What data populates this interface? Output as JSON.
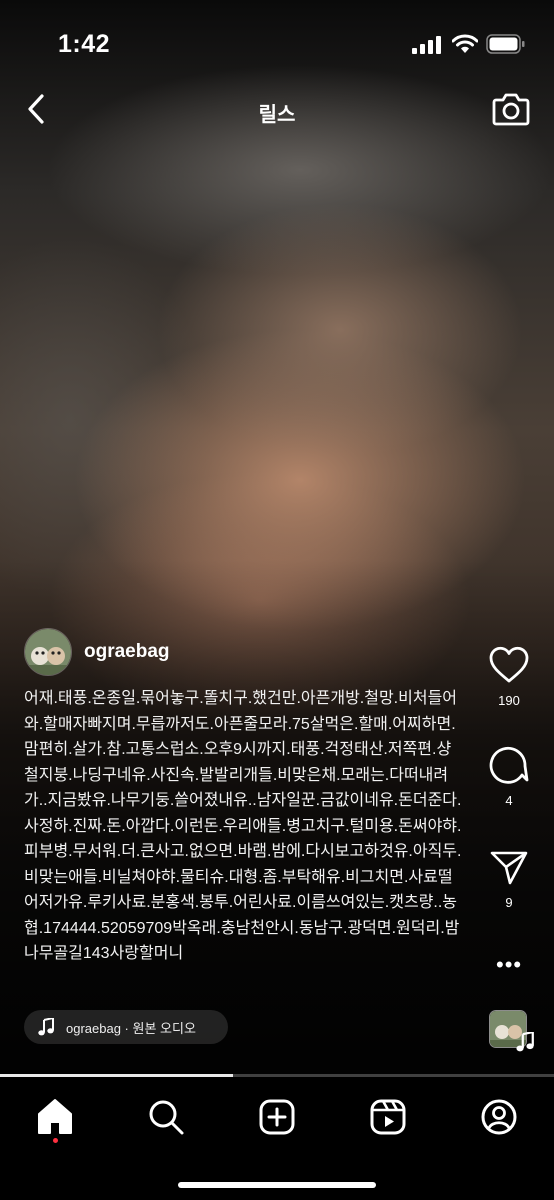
{
  "status_bar": {
    "time": "1:42"
  },
  "header": {
    "title": "릴스"
  },
  "post": {
    "username": "ograebag",
    "caption": "어재.태풍.온종일.묶어놓구.똘치구.했건만.아픈개방.철망.비처들어와.할매자빠지며.무릅까저도.아픈줄모라.75살먹은.할매.어찌하면.맘편히.살가.참.고통스럽소.오후9시까지.태풍.걱정태산.저쪽편.샹철지붕.나딩구네유.사진속.발발리개들.비맞은채.모래는.다떠내려가..지금봤유.나무기둥.쓸어졌내유..남자일꾼.금값이네유.돈더준다.사정하.진짜.돈.아깝다.이런돈.우리애들.병고치구.털미용.돈써야햐.피부병.무서워.더.큰사고.없으면.바램.밤에.다시보고하것유.아직두.비맞는애들.비닐쳐야햐.물티슈.대형.좀.부탁해유.비그치면.사료떨어저가유.루키사료.분홍색.봉투.어린사료.이름쓰여있는.캣츠량..농협.174444.52059709박옥래.충남천안시.동남구.광덕면.원덕리.밤나무골길143사랑할머니",
    "audio": {
      "label": "ograebag · 원본 오디오"
    },
    "likes": "190",
    "comments": "4",
    "shares": "9",
    "progress": 0.42
  },
  "nav": {
    "items": [
      "home",
      "search",
      "create",
      "reels",
      "profile"
    ],
    "active": "home"
  },
  "colors": {
    "accent_dot": "#ff3040"
  }
}
